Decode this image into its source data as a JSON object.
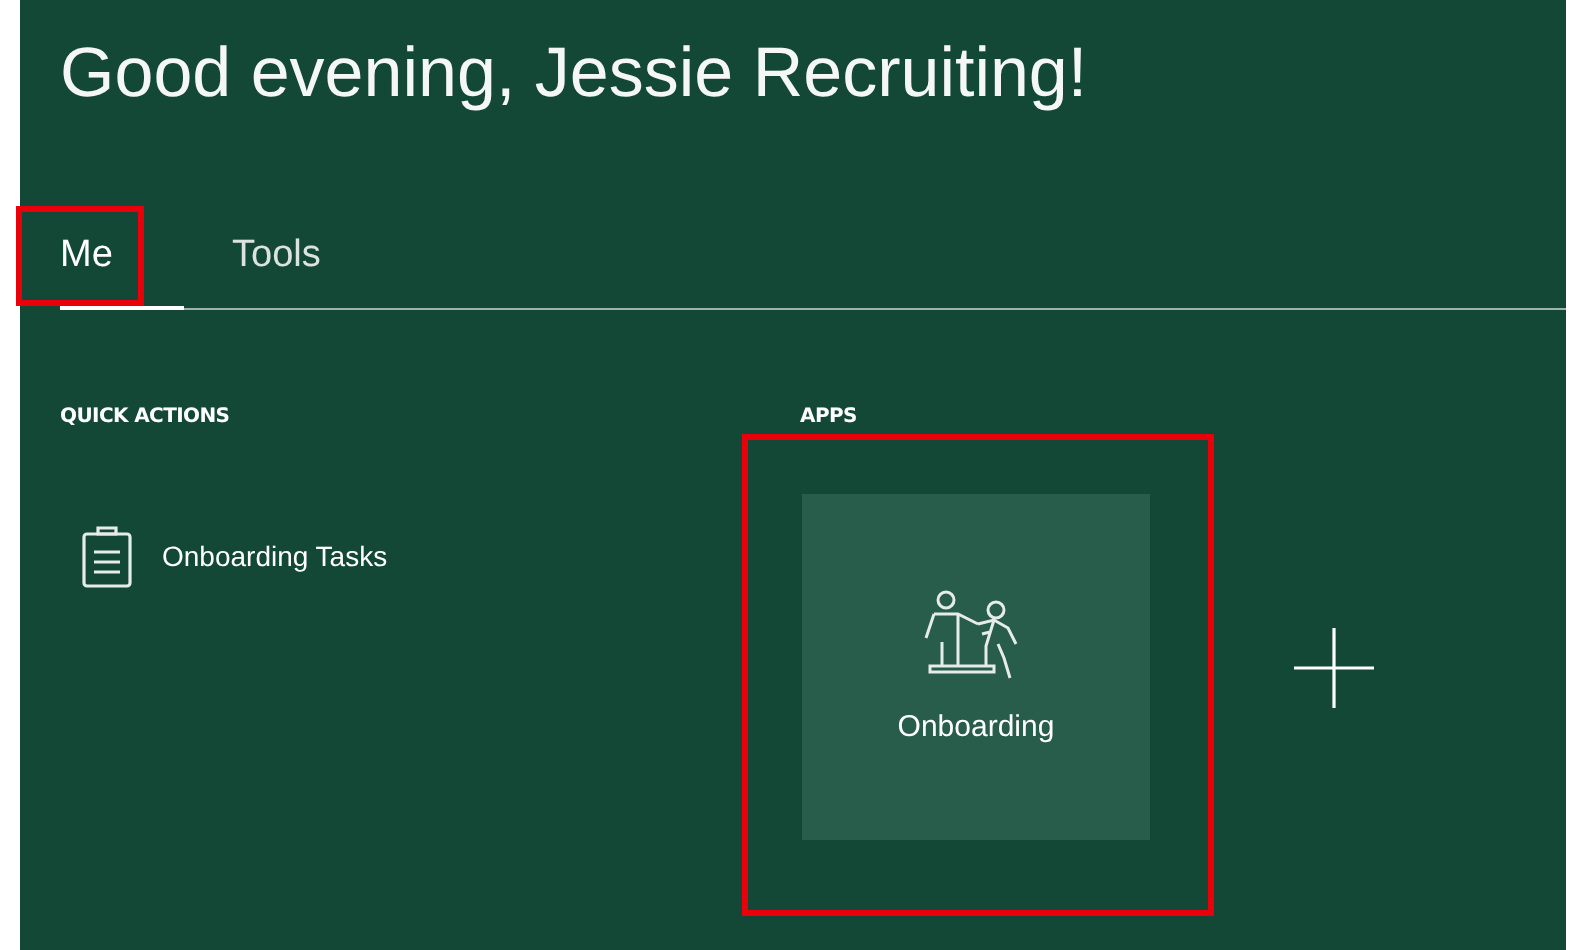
{
  "greeting": "Good evening, Jessie Recruiting!",
  "tabs": [
    {
      "label": "Me",
      "selected": true,
      "highlighted": true
    },
    {
      "label": "Tools",
      "selected": false,
      "highlighted": false
    }
  ],
  "quick_actions": {
    "heading": "QUICK ACTIONS",
    "items": [
      {
        "label": "Onboarding Tasks"
      }
    ]
  },
  "apps": {
    "heading": "APPS",
    "items": [
      {
        "label": "Onboarding",
        "highlighted": true
      }
    ]
  }
}
